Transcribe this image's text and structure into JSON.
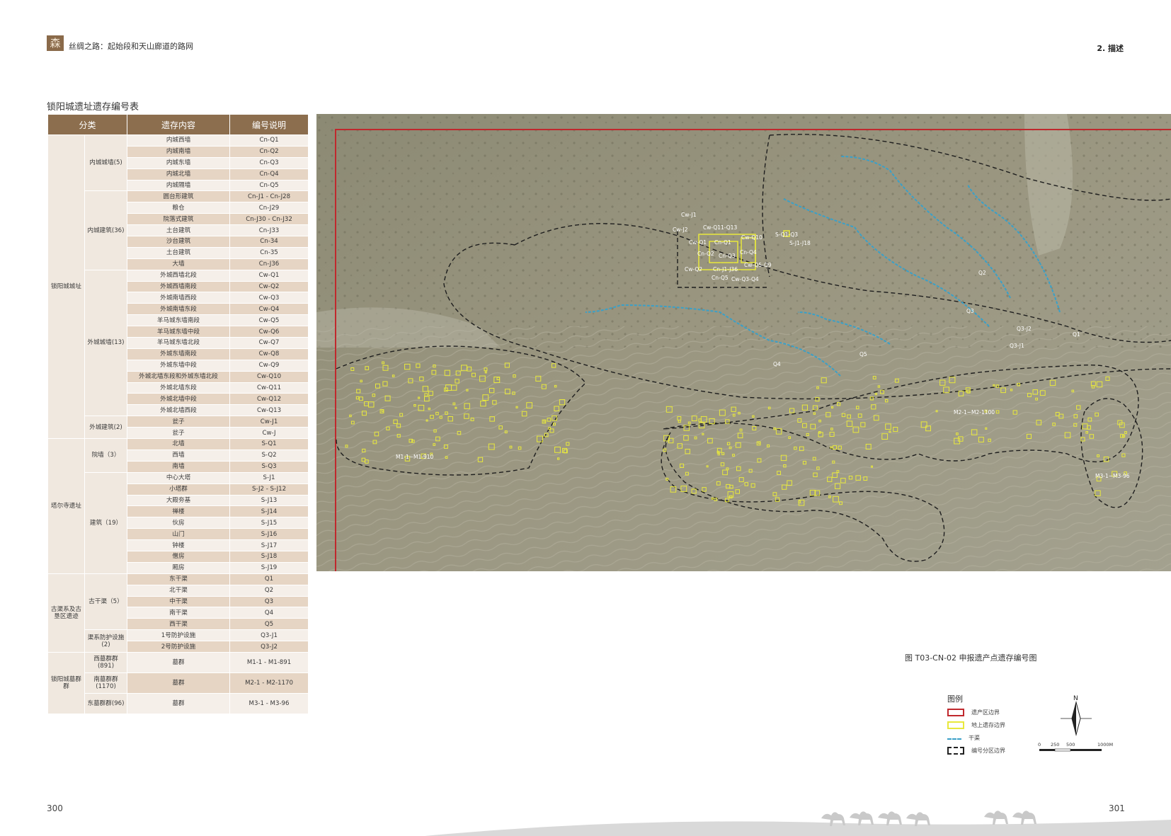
{
  "header": {
    "logo_glyph": "森",
    "title": "丝绸之路：起始段和天山廊道的路网",
    "section": "2. 描述"
  },
  "table": {
    "title": "锁阳城遗址遗存编号表",
    "headers": [
      "分类",
      "遗存内容",
      "编号说明"
    ],
    "groups": [
      {
        "name": "锁阳城城址",
        "subgroups": [
          {
            "name": "内城城墙(5)",
            "rows": [
              [
                "内城西墙",
                "Cn-Q1"
              ],
              [
                "内城南墙",
                "Cn-Q2"
              ],
              [
                "内城东墙",
                "Cn-Q3"
              ],
              [
                "内城北墙",
                "Cn-Q4"
              ],
              [
                "内城隔墙",
                "Cn-Q5"
              ]
            ]
          },
          {
            "name": "内城建筑(36)",
            "rows": [
              [
                "圆台形建筑",
                "Cn-J1 - Cn-J28"
              ],
              [
                "粮仓",
                "Cn-J29"
              ],
              [
                "院落式建筑",
                "Cn-J30 - Cn-J32"
              ],
              [
                "土台建筑",
                "Cn-J33"
              ],
              [
                "沙台建筑",
                "Cn-34"
              ],
              [
                "土台建筑",
                "Cn-35"
              ],
              [
                "大墙",
                "Cn-J36"
              ]
            ]
          },
          {
            "name": "外城城墙(13)",
            "rows": [
              [
                "外城西墙北段",
                "Cw-Q1"
              ],
              [
                "外城西墙南段",
                "Cw-Q2"
              ],
              [
                "外城南墙西段",
                "Cw-Q3"
              ],
              [
                "外城南墙东段",
                "Cw-Q4"
              ],
              [
                "羊马城东墙南段",
                "Cw-Q5"
              ],
              [
                "羊马城东墙中段",
                "Cw-Q6"
              ],
              [
                "羊马城东墙北段",
                "Cw-Q7"
              ],
              [
                "外城东墙南段",
                "Cw-Q8"
              ],
              [
                "外城东墙中段",
                "Cw-Q9"
              ],
              [
                "外城北墙东段和外城东墙北段",
                "Cw-Q10"
              ],
              [
                "外城北墙东段",
                "Cw-Q11"
              ],
              [
                "外城北墙中段",
                "Cw-Q12"
              ],
              [
                "外城北墙西段",
                "Cw-Q13"
              ]
            ]
          },
          {
            "name": "外城建筑(2)",
            "rows": [
              [
                "瓮子",
                "Cw-J1"
              ],
              [
                "瓮子",
                "Cw-J"
              ]
            ]
          }
        ]
      },
      {
        "name": "塔尔寺遗址",
        "subgroups": [
          {
            "name": "院墙（3）",
            "rows": [
              [
                "北墙",
                "S-Q1"
              ],
              [
                "西墙",
                "S-Q2"
              ],
              [
                "南墙",
                "S-Q3"
              ]
            ]
          },
          {
            "name": "建筑（19）",
            "rows": [
              [
                "中心大塔",
                "S-J1"
              ],
              [
                "小塔群",
                "S-J2 - S-J12"
              ],
              [
                "大殿夯基",
                "S-J13"
              ],
              [
                "禅楼",
                "S-J14"
              ],
              [
                "伙房",
                "S-J15"
              ],
              [
                "山门",
                "S-J16"
              ],
              [
                "钟楼",
                "S-J17"
              ],
              [
                "僧房",
                "S-J18"
              ],
              [
                "厢房",
                "S-J19"
              ]
            ]
          }
        ]
      },
      {
        "name": "古渠系及古垦区遗迹",
        "subgroups": [
          {
            "name": "古干渠（5）",
            "rows": [
              [
                "东干渠",
                "Q1"
              ],
              [
                "北干渠",
                "Q2"
              ],
              [
                "中干渠",
                "Q3"
              ],
              [
                "南干渠",
                "Q4"
              ],
              [
                "西干渠",
                "Q5"
              ]
            ]
          },
          {
            "name": "渠系防护设施(2)",
            "rows": [
              [
                "1号防护设施",
                "Q3-J1"
              ],
              [
                "2号防护设施",
                "Q3-J2"
              ]
            ]
          }
        ]
      },
      {
        "name": "锁阳城墓群群",
        "subgroups": [
          {
            "name": "西墓群群(891)",
            "rows": [
              [
                "墓群",
                "M1-1 - M1-891"
              ]
            ]
          },
          {
            "name": "南墓群群(1170)",
            "rows": [
              [
                "墓群",
                "M2-1 - M2-1170"
              ]
            ]
          },
          {
            "name": "东墓群群(96)",
            "rows": [
              [
                "墓群",
                "M3-1 - M3-96"
              ]
            ]
          }
        ]
      }
    ]
  },
  "map": {
    "labels": {
      "cw_j1": "Cw-J1",
      "cw_j2": "Cw-J2",
      "cw_q11_q13": "Cw-Q11-Q13",
      "cw_q1": "Cw-Q1",
      "cn_q1": "Cn-Q1",
      "cw_q10": "Cw-Q10",
      "cn_q2": "Cn-Q2",
      "cn_q4": "Cn-Q4",
      "cn_q3": "Cn-Q3",
      "cw_q2": "Cw-Q2",
      "cn_j1_j36": "Cn-J1-J36",
      "cw_q5_q9": "Cw-Q5-Q9",
      "cn_q5": "Cn-Q5",
      "cw_q3_q4": "Cw-Q3-Q4",
      "s_q1_q3": "S-Q1-Q3",
      "s_j1_j18": "S-J1-J18",
      "q1": "Q1",
      "q2": "Q2",
      "q3": "Q3",
      "q4": "Q4",
      "q5": "Q5",
      "q3_j1": "Q3-J1",
      "q3_j2": "Q3-J2",
      "m1": "M1-1~M1-910",
      "m2": "M2-1~M2-1100",
      "m3": "M3-1~M3-96"
    }
  },
  "figure_caption": "图 T03-CN-02 申报遗产点遗存编号图",
  "legend": {
    "title": "图例",
    "items": [
      {
        "label": "遗产区边界",
        "color": "#c0282d"
      },
      {
        "label": "地上遗存边界",
        "color": "#e8e83c"
      },
      {
        "label": "干渠",
        "color": "#3aa0c8"
      },
      {
        "label": "编号分区边界",
        "color": "#222222"
      }
    ],
    "north": "N",
    "scale": [
      "0",
      "250",
      "500",
      "1000M"
    ]
  },
  "page_numbers": {
    "left": "300",
    "right": "301"
  }
}
